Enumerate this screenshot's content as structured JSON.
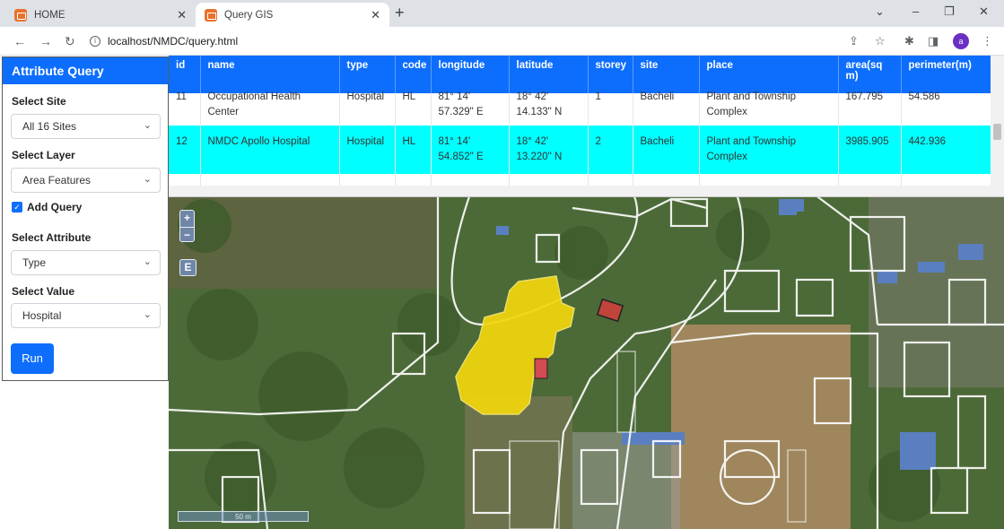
{
  "browser": {
    "tabs": [
      {
        "label": "HOME",
        "active": false
      },
      {
        "label": "Query GIS",
        "active": true
      }
    ],
    "url": "localhost/NMDC/query.html",
    "profile_initial": "a"
  },
  "panel": {
    "title": "Attribute Query",
    "site_label": "Select Site",
    "site_value": "All 16 Sites",
    "layer_label": "Select Layer",
    "layer_value": "Area Features",
    "add_query_label": "Add Query",
    "add_query_checked": true,
    "attribute_label": "Select Attribute",
    "attribute_value": "Type",
    "value_label": "Select Value",
    "value_value": "Hospital",
    "run_label": "Run"
  },
  "table": {
    "headers": [
      "id",
      "name",
      "type",
      "code",
      "longitude",
      "latitude",
      "storey",
      "site",
      "place",
      "area(sq m)",
      "perimeter(m)"
    ],
    "rows": [
      {
        "id": "11",
        "name": "Occupational Health Center",
        "type": "Hospital",
        "code": "HL",
        "longitude": "81° 14' 57.329\" E",
        "latitude": "18° 42' 14.133\" N",
        "storey": "1",
        "site": "Bacheli",
        "place": "Plant and Township Complex",
        "area": "167.795",
        "perimeter": "54.586",
        "clipped": true
      },
      {
        "id": "12",
        "name": "NMDC Apollo Hospital",
        "type": "Hospital",
        "code": "HL",
        "longitude": "81° 14' 54.852\" E",
        "latitude": "18° 42' 13.220\" N",
        "storey": "2",
        "site": "Bacheli",
        "place": "Plant and Township Complex",
        "area": "3985.905",
        "perimeter": "442.936",
        "highlighted": true
      }
    ]
  },
  "map": {
    "zoom_in": "+",
    "zoom_out": "−",
    "extent_button": "E",
    "scale_text": "50 m",
    "highlight_color": "#f2d60c"
  }
}
